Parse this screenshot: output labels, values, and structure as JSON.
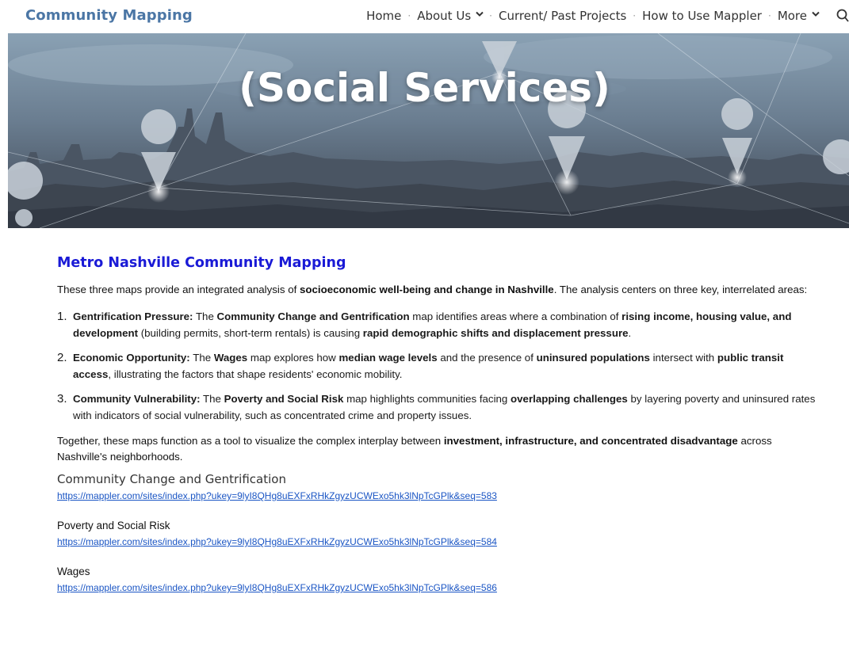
{
  "header": {
    "site_title": "Community Mapping",
    "nav": [
      {
        "label": "Home",
        "has_dropdown": false
      },
      {
        "label": "About Us",
        "has_dropdown": true
      },
      {
        "label": "Current/ Past Projects",
        "has_dropdown": false
      },
      {
        "label": "How to Use Mappler",
        "has_dropdown": false
      },
      {
        "label": "More",
        "has_dropdown": true
      }
    ],
    "separator": "·",
    "search_icon": "search-icon"
  },
  "hero": {
    "title": "(Social Services)"
  },
  "main": {
    "heading": "Metro Nashville Community Mapping",
    "intro": {
      "pre": "These three maps provide an integrated analysis of ",
      "bold": "socioeconomic well-being and change in Nashville",
      "post": ". The analysis centers on three key, interrelated areas:"
    },
    "areas": [
      {
        "num": "1.",
        "parts": [
          {
            "b": "Gentrification Pressure:"
          },
          {
            "t": " The "
          },
          {
            "b": "Community Change and Gentrification"
          },
          {
            "t": " map identifies areas where a combination of "
          },
          {
            "b": "rising income, housing value, and development"
          },
          {
            "t": " (building permits, short-term rentals) is causing "
          },
          {
            "b": "rapid demographic shifts and displacement pressure"
          },
          {
            "t": "."
          }
        ]
      },
      {
        "num": "2.",
        "parts": [
          {
            "b": "Economic Opportunity:"
          },
          {
            "t": " The "
          },
          {
            "b": "Wages"
          },
          {
            "t": " map explores how "
          },
          {
            "b": "median wage levels"
          },
          {
            "t": " and the presence of "
          },
          {
            "b": "uninsured populations"
          },
          {
            "t": " intersect with "
          },
          {
            "b": "public transit access"
          },
          {
            "t": ", illustrating the factors that shape residents' economic mobility."
          }
        ]
      },
      {
        "num": "3.",
        "parts": [
          {
            "b": "Community Vulnerability:"
          },
          {
            "t": " The "
          },
          {
            "b": "Poverty and Social Risk"
          },
          {
            "t": " map highlights communities facing "
          },
          {
            "b": "overlapping challenges"
          },
          {
            "t": " by layering poverty and uninsured rates with indicators of social vulnerability, such as concentrated crime and property issues."
          }
        ]
      }
    ],
    "closing": {
      "pre": "Together, these maps function as a tool to visualize the complex interplay between ",
      "bold": "investment, infrastructure, and concentrated disadvantage",
      "post": " across Nashville's neighborhoods."
    },
    "maps": [
      {
        "title": "Community Change and Gentrification",
        "url": "https://mappler.com/sites/index.php?ukey=9lyI8QHg8uEXFxRHkZgyzUCWExo5hk3lNpTcGPlk&seq=583"
      },
      {
        "title": "Poverty and Social Risk",
        "url": "https://mappler.com/sites/index.php?ukey=9lyI8QHg8uEXFxRHkZgyzUCWExo5hk3lNpTcGPlk&seq=584"
      },
      {
        "title": "Wages",
        "url": "https://mappler.com/sites/index.php?ukey=9lyI8QHg8uEXFxRHkZgyzUCWExo5hk3lNpTcGPlk&seq=586"
      }
    ]
  },
  "colors": {
    "site_title": "#4b76a5",
    "heading": "#1a1ad6",
    "link": "#1a55c4"
  }
}
